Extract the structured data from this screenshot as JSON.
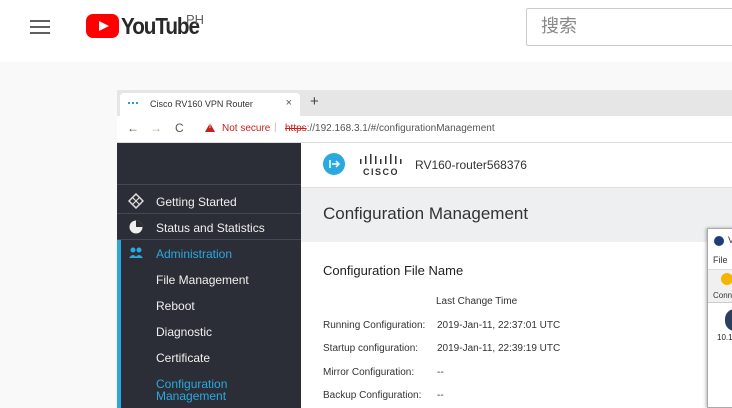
{
  "youtube": {
    "logo_text": "YouTube",
    "region": "PH",
    "search_placeholder": "搜索"
  },
  "browser": {
    "tab_title": "Cisco RV160 VPN Router",
    "tab_close": "×",
    "new_tab": "+",
    "nav": {
      "back": "←",
      "forward": "→",
      "reload": "C"
    },
    "security_label": "Not secure",
    "url_separator": "|",
    "url_protocol": "https",
    "url_rest": "://192.168.3.1/#/configurationManagement"
  },
  "router": {
    "device_name": "RV160-router568376",
    "cisco_wordmark": "CISCO",
    "sidebar": {
      "items": [
        {
          "label": "Getting Started",
          "icon": "getting-started-icon"
        },
        {
          "label": "Status and Statistics",
          "icon": "pie-chart-icon"
        },
        {
          "label": "Administration",
          "icon": "users-icon"
        }
      ],
      "sub_items": [
        {
          "label": "File Management"
        },
        {
          "label": "Reboot"
        },
        {
          "label": "Diagnostic"
        },
        {
          "label": "Certificate"
        },
        {
          "label": "Configuration Management",
          "lines": [
            "Configuration",
            "Management"
          ]
        }
      ]
    },
    "page_title": "Configuration Management",
    "section_title": "Configuration File Name",
    "column_header": "Last Change Time",
    "rows": [
      {
        "label": "Running Configuration:",
        "value": "2019-Jan-11, 22:37:01 UTC"
      },
      {
        "label": "Startup configuration:",
        "value": "2019-Jan-11, 22:39:19 UTC"
      },
      {
        "label": "Mirror Configuration:",
        "value": "--"
      },
      {
        "label": "Backup Configuration:",
        "value": "--"
      }
    ]
  },
  "overlay": {
    "title": "V",
    "file_menu": "File",
    "connect_label": "Conn",
    "ip_text": "10.1"
  },
  "colors": {
    "youtube_red": "#ff0000",
    "sidebar_bg": "#2b2e36",
    "accent_blue": "#2aa9e0",
    "warning_red": "#c5221f"
  }
}
